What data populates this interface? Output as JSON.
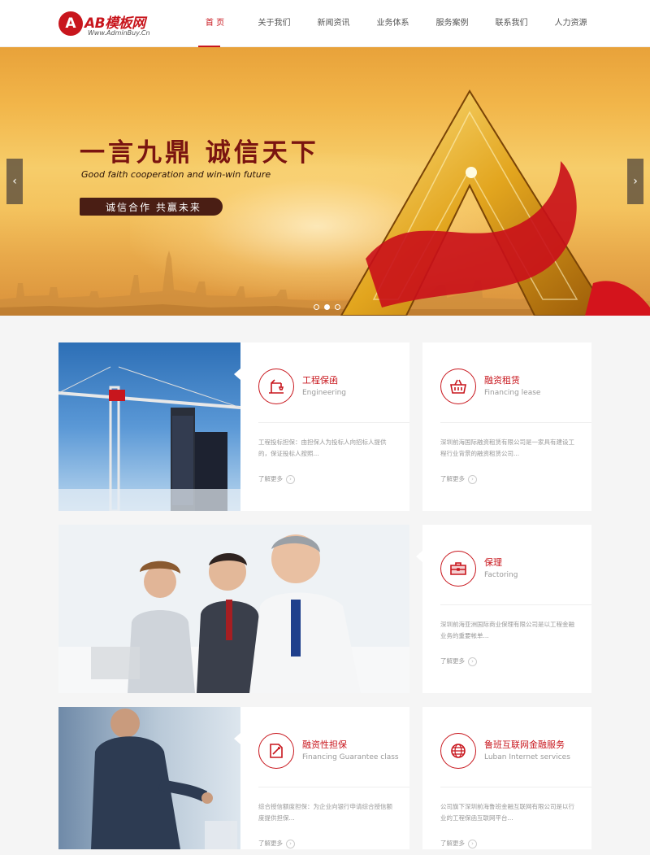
{
  "header": {
    "logo_mark": "A",
    "logo_title": "AB模板网",
    "logo_url": "Www.AdminBuy.Cn",
    "nav": [
      "首 页",
      "关于我们",
      "新闻资讯",
      "业务体系",
      "服务案例",
      "联系我们",
      "人力资源"
    ],
    "active_index": 0
  },
  "banner": {
    "headline": "一言九鼎  诚信天下",
    "subline": "Good faith cooperation and win-win future",
    "tag": "诚信合作  共赢未来",
    "prev": "‹",
    "next": "›",
    "slide_count": 3,
    "active_slide": 1
  },
  "services": [
    {
      "title": "工程保函",
      "subtitle": "Engineering",
      "desc": "工程投标担保：由担保人为投标人向招标人提供的，保证投标人按照...",
      "more": "了解更多",
      "icon": "crane-icon"
    },
    {
      "title": "融资租赁",
      "subtitle": "Financing lease",
      "desc": "深圳前海国际融资租赁有限公司是一家具有建设工程行业背景的融资租赁公司...",
      "more": "了解更多",
      "icon": "basket-icon"
    },
    {
      "title": "保理",
      "subtitle": "Factoring",
      "desc": "深圳前海亚洲国际商业保理有限公司是以工程金融业务的重要帐单...",
      "more": "了解更多",
      "icon": "briefcase-icon"
    },
    {
      "title": "融资性担保",
      "subtitle": "Financing Guarantee class",
      "desc": "综合授信额度担保：为企业向银行申请综合授信额度提供担保...",
      "more": "了解更多",
      "icon": "document-pen-icon"
    },
    {
      "title": "鲁班互联网金融服务",
      "subtitle": "Luban Internet services",
      "desc": "公司旗下深圳前海鲁班金融互联网有限公司是以行业的工程保函互联网平台...",
      "more": "了解更多",
      "icon": "globe-icon"
    }
  ],
  "colors": {
    "brand": "#c8161d",
    "text": "#555555",
    "muted": "#999999"
  }
}
